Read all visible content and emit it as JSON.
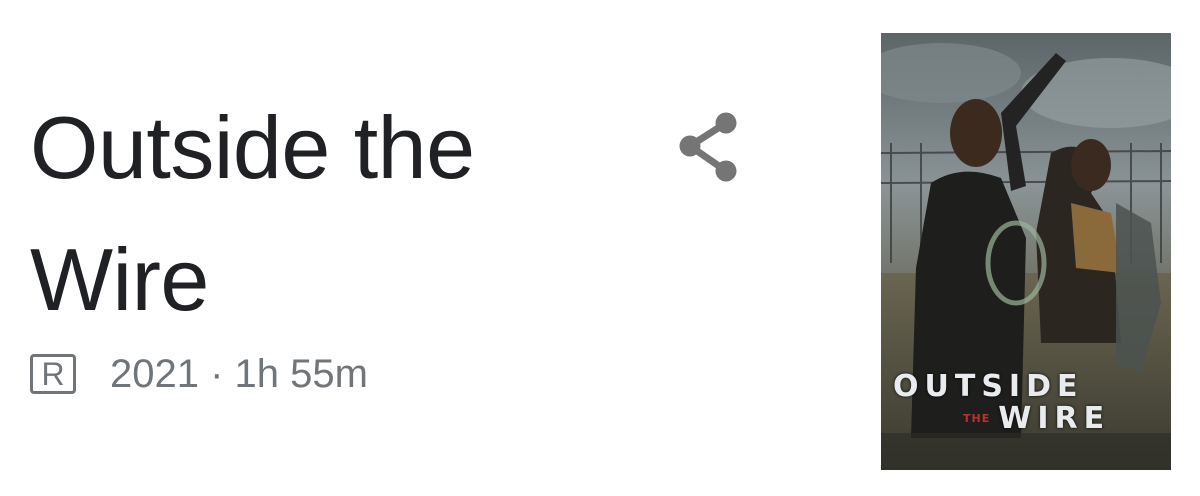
{
  "movie": {
    "title": "Outside the Wire",
    "rating": "R",
    "meta": "2021 · 1h 55m"
  },
  "actions": {
    "share_icon": "share-icon"
  },
  "poster": {
    "line1": "OUTSIDE",
    "the": "THE",
    "line2": "WIRE"
  },
  "colors": {
    "title": "#202124",
    "secondary": "#70757a",
    "share": "#757575"
  }
}
